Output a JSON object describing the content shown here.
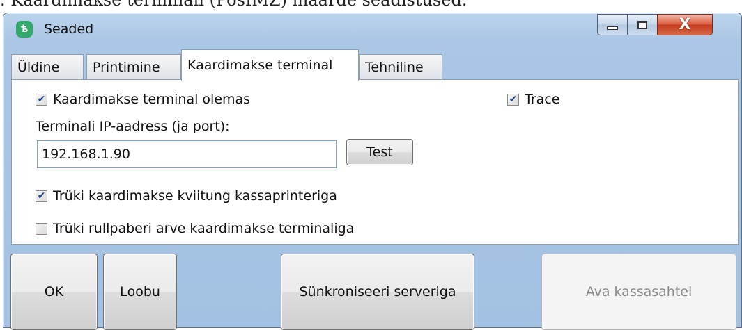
{
  "doc_caption": ". Kaardimakse terminali (PosIMZ) määrde seadistused.",
  "window": {
    "title": "Seaded",
    "app_icon": "seaded-app-icon",
    "caption_buttons": [
      "minimize-icon",
      "maximize-icon",
      "close-icon"
    ],
    "close_glyph": "X"
  },
  "tabs": [
    {
      "label": "Üldine",
      "active": false
    },
    {
      "label": "Printimine",
      "active": false
    },
    {
      "label": "Kaardimakse terminal",
      "active": true
    },
    {
      "label": "Tehniline",
      "active": false
    }
  ],
  "panel": {
    "terminal_present": {
      "label": "Kaardimakse terminal olemas",
      "checked": true
    },
    "trace": {
      "label": "Trace",
      "checked": true
    },
    "ip_label": "Terminali IP-aadress (ja port):",
    "ip_value": "192.168.1.90",
    "test_button": "Test",
    "print_card_receipt": {
      "label": "Trüki kaardimakse kviitung kassaprinteriga",
      "checked": true
    },
    "print_roll_invoice": {
      "label": "Trüki rullpaberi arve kaardimakse terminaliga",
      "checked": false
    }
  },
  "buttons": {
    "ok": {
      "mnemonic": "O",
      "rest": "K"
    },
    "cancel": {
      "mnemonic": "L",
      "rest": "oobu"
    },
    "sync": {
      "mnemonic": "S",
      "rest": "ünkroniseeri serveriga"
    },
    "drawer": "Ava kassasahtel"
  },
  "check_glyph": "✔",
  "colors": {
    "accent": "#32a96b",
    "close": "#c23b1c",
    "disabled_text": "#8a8a8a"
  }
}
